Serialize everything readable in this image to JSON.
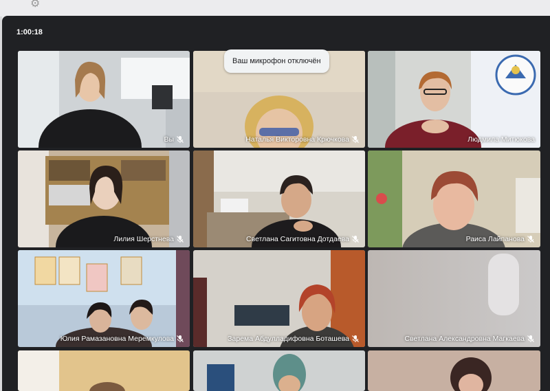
{
  "app": {
    "timer": "1:00:18",
    "toast": "Ваш микрофон отключён"
  },
  "icons": {
    "settings": "gear-icon",
    "mic_off": "mic-off-icon"
  },
  "colors": {
    "background": "#202124",
    "active_speaker_border": "#34a853",
    "toast_bg": "#f1f3f4"
  },
  "participants": [
    {
      "name": "Вы",
      "muted": true,
      "active": false
    },
    {
      "name": "Наталья Викторовна Крючкова",
      "muted": true,
      "active": false
    },
    {
      "name": "Людмила Митюкова",
      "muted": false,
      "active": true
    },
    {
      "name": "Лилия Шерстнева",
      "muted": true,
      "active": false
    },
    {
      "name": "Светлана Сагитовна Дотдаева",
      "muted": true,
      "active": false
    },
    {
      "name": "Раиса Лайпанова",
      "muted": true,
      "active": false
    },
    {
      "name": "Юлия Рамазановна Меремкулова",
      "muted": true,
      "active": false
    },
    {
      "name": "Зарема Абдулладифовна Боташева",
      "muted": true,
      "active": false
    },
    {
      "name": "Светлана Александровна Магкаева",
      "muted": true,
      "active": false
    },
    {
      "name": "",
      "muted": false,
      "active": false
    },
    {
      "name": "",
      "muted": false,
      "active": false
    },
    {
      "name": "",
      "muted": false,
      "active": false
    }
  ]
}
